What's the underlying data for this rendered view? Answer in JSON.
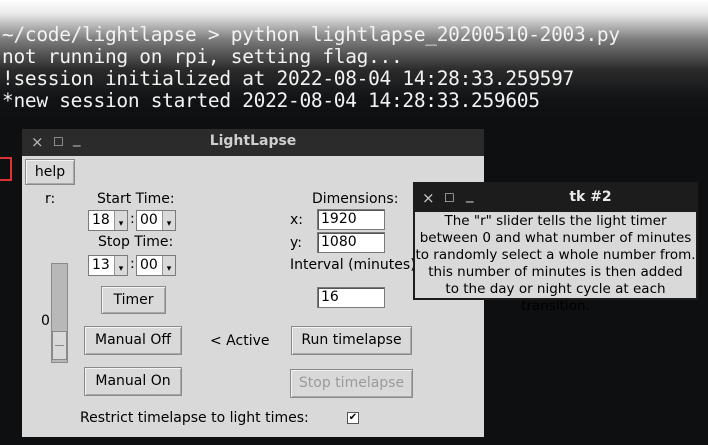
{
  "terminal": {
    "lines": [
      "                                          ",
      "~/code/lightlapse > python lightlapse_20200510-2003.py",
      "not running on rpi, setting flag...",
      "!session initialized at 2022-08-04 14:28:33.259597",
      "*new session started 2022-08-04 14:28:33.259605"
    ]
  },
  "main_window": {
    "title": "LightLapse",
    "close_glyph": "×",
    "max_glyph": "☐",
    "min_glyph": "_",
    "help_label": "help",
    "r_label": "r:",
    "slider_value": "0",
    "start_time_label": "Start Time:",
    "start_hour": "18",
    "start_minute": "00",
    "stop_time_label": "Stop Time:",
    "stop_hour": "13",
    "stop_minute": "00",
    "colon": ":",
    "timer_label": "Timer",
    "dimensions_label": "Dimensions:",
    "x_label": "x:",
    "x_value": "1920",
    "y_label": "y:",
    "y_value": "1080",
    "interval_label": "Interval (minutes):",
    "interval_value": "16",
    "manual_off_label": "Manual Off",
    "active_label": "< Active",
    "run_timelapse_label": "Run timelapse",
    "manual_on_label": "Manual On",
    "stop_timelapse_label": "Stop timelapse",
    "restrict_label": "Restrict timelapse to light times:",
    "restrict_checked": "✔",
    "spin_arrow": "▾"
  },
  "tooltip_window": {
    "title": "tk #2",
    "close_glyph": "×",
    "max_glyph": "☐",
    "min_glyph": "_",
    "lines": [
      "The \"r\" slider tells the light timer",
      "between 0 and what number of minutes",
      "to randomly select a whole number from.",
      "this number of minutes is then added",
      "to the day or night cycle at each transition."
    ]
  }
}
